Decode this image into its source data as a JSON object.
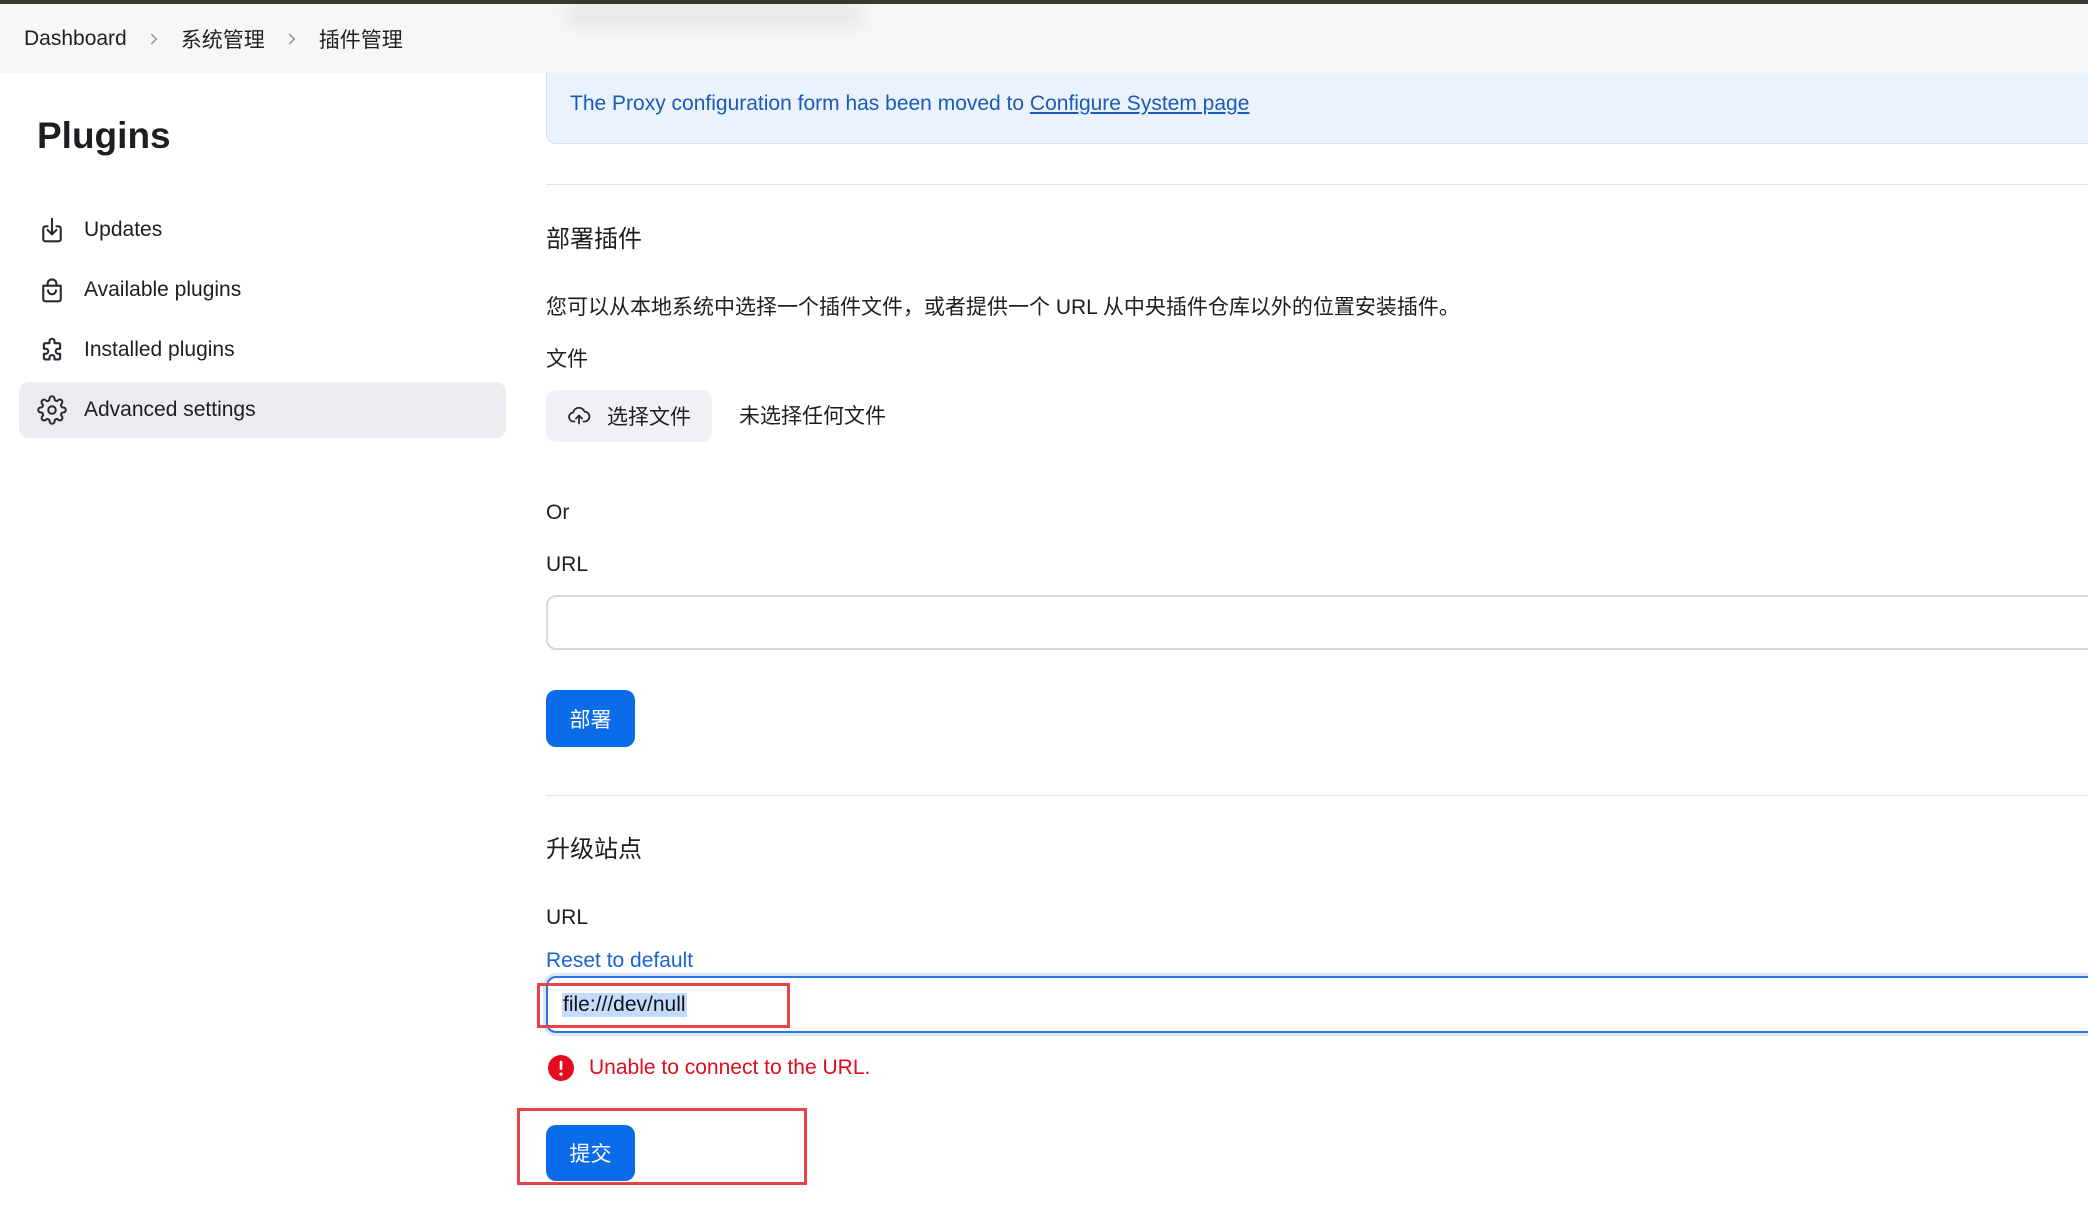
{
  "breadcrumb": {
    "items": [
      "Dashboard",
      "系统管理",
      "插件管理"
    ],
    "separator_icon": "chevron-right-icon"
  },
  "sidebar": {
    "title": "Plugins",
    "items": [
      {
        "label": "Updates",
        "icon": "download-icon"
      },
      {
        "label": "Available plugins",
        "icon": "shopping-bag-icon"
      },
      {
        "label": "Installed plugins",
        "icon": "puzzle-icon"
      },
      {
        "label": "Advanced settings",
        "icon": "gear-icon"
      }
    ]
  },
  "notice": {
    "text": "The Proxy configuration form has been moved to",
    "link": "Configure System page"
  },
  "deploy_plugin": {
    "heading": "部署插件",
    "description": "您可以从本地系统中选择一个插件文件，或者提供一个 URL 从中央插件仓库以外的位置安装插件。",
    "file_label": "文件",
    "file_button": "选择文件",
    "file_button_icon": "cloud-upload-icon",
    "file_status": "未选择任何文件",
    "or_label": "Or",
    "url_label": "URL",
    "url_value": "",
    "button": "部署"
  },
  "update_site": {
    "heading": "升级站点",
    "url_label": "URL",
    "reset_link": "Reset to default",
    "url_value": "file:///dev/null",
    "error_icon": "alert-circle-icon",
    "error": "Unable to connect to the URL.",
    "button": "提交"
  },
  "colors": {
    "primary": "#0b6ce9",
    "error": "#e30b1c",
    "link": "#1765d1",
    "annotation": "#e8434b",
    "text": "#1d1e22"
  }
}
